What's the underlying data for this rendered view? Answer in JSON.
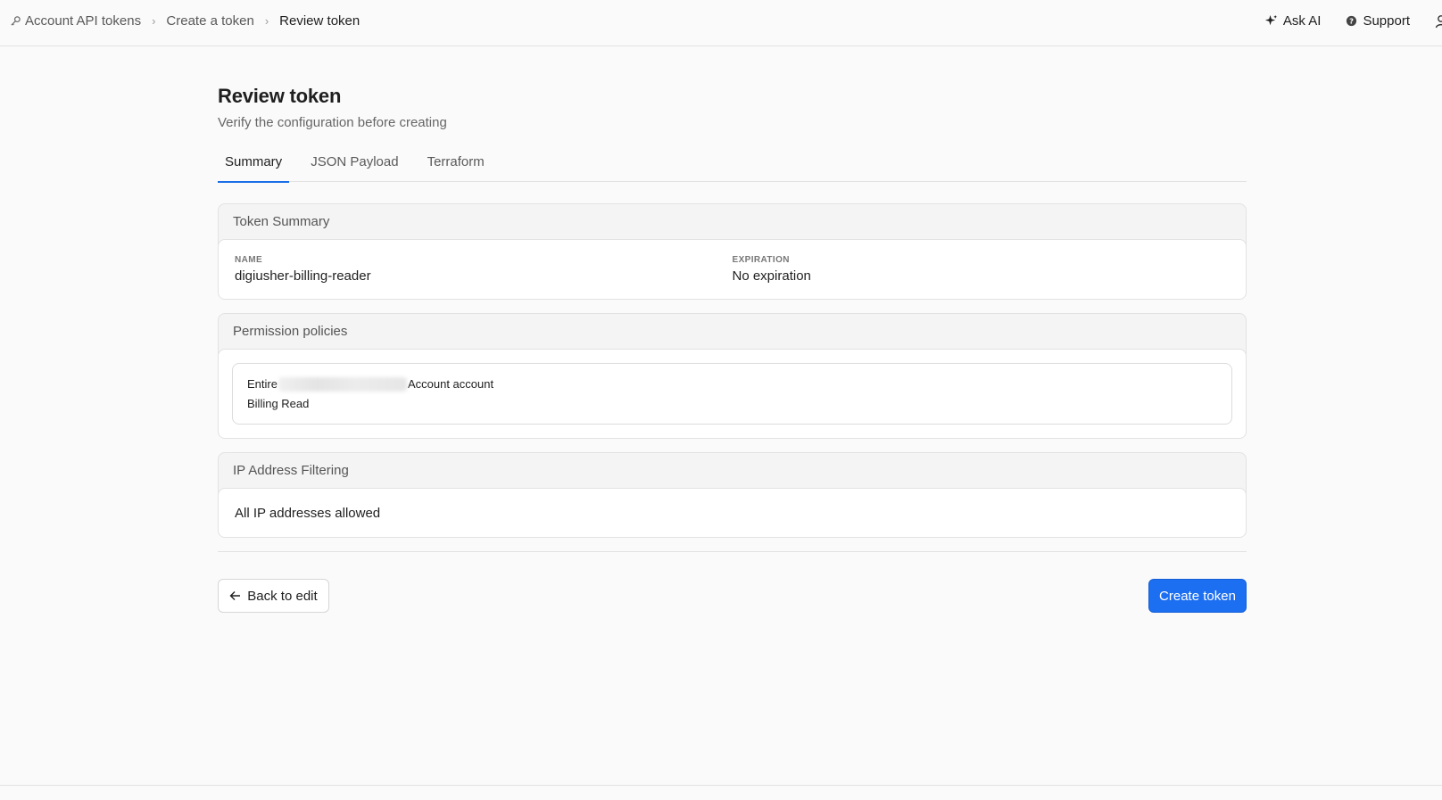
{
  "breadcrumb": {
    "items": [
      {
        "label": "Account API tokens",
        "icon": "key-icon"
      },
      {
        "label": "Create a token"
      },
      {
        "label": "Review token"
      }
    ]
  },
  "top_actions": {
    "ask_ai": "Ask AI",
    "support": "Support"
  },
  "page": {
    "title": "Review token",
    "subtitle": "Verify the configuration before creating"
  },
  "tabs": [
    {
      "label": "Summary",
      "active": true
    },
    {
      "label": "JSON Payload",
      "active": false
    },
    {
      "label": "Terraform",
      "active": false
    }
  ],
  "token_summary": {
    "header": "Token Summary",
    "name_label": "NAME",
    "name_value": "digiusher-billing-reader",
    "expiration_label": "EXPIRATION",
    "expiration_value": "No expiration"
  },
  "permissions": {
    "header": "Permission policies",
    "scope_prefix": "Entire",
    "scope_suffix": "Account account",
    "permission": "Billing Read"
  },
  "ip_filtering": {
    "header": "IP Address Filtering",
    "value": "All IP addresses allowed"
  },
  "buttons": {
    "back": "Back to edit",
    "create": "Create token"
  },
  "colors": {
    "accent": "#1d6ff2",
    "background": "#fafafa",
    "border": "#e2e2e2"
  }
}
